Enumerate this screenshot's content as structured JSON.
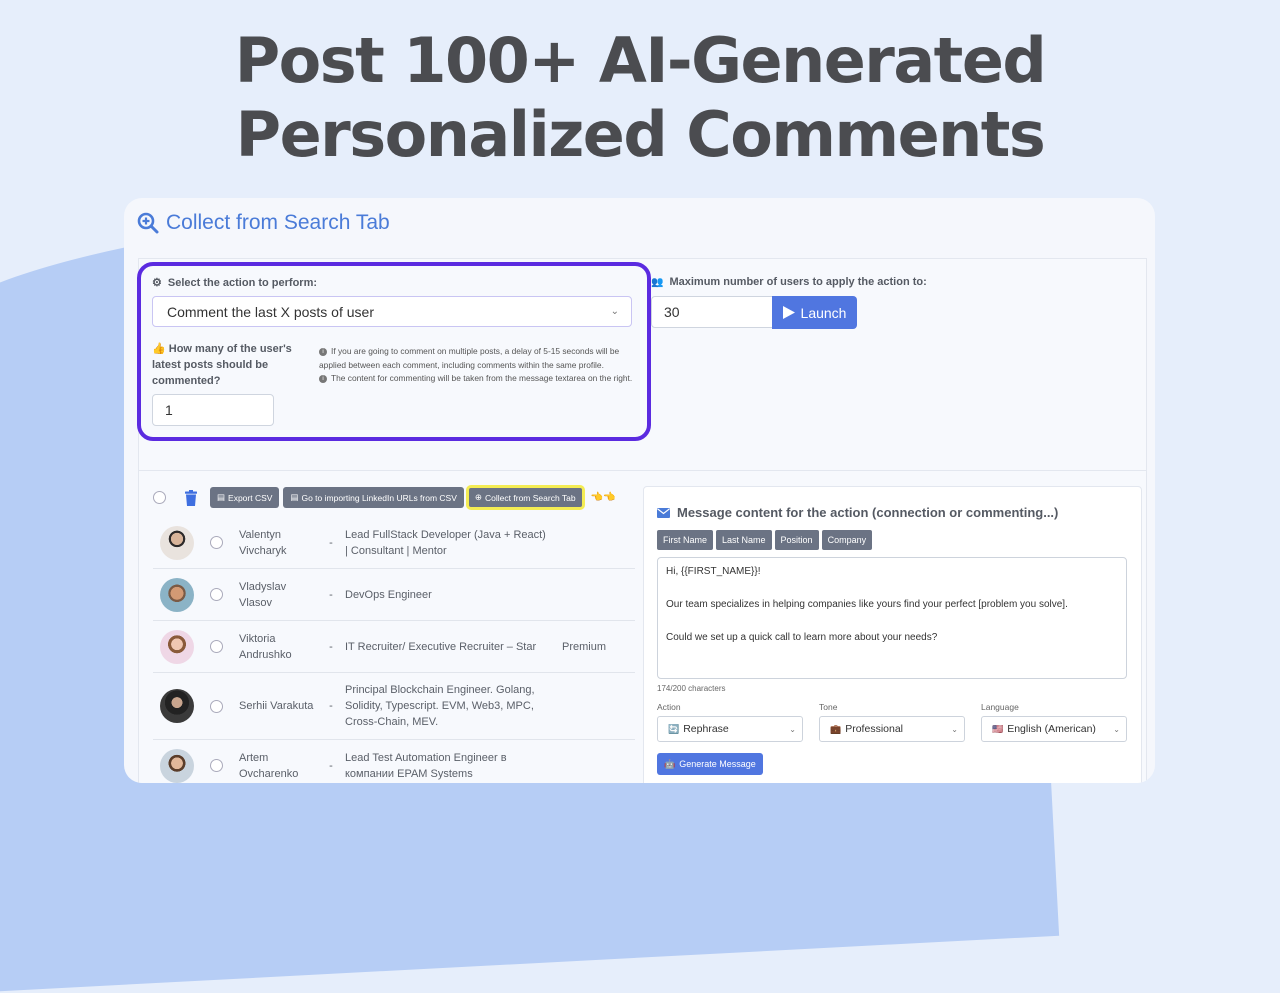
{
  "hero": {
    "line1": "Post 100+ AI-Generated",
    "line2": "Personalized Comments"
  },
  "card": {
    "title": "Collect from Search Tab",
    "title_icon": "search-plus-icon"
  },
  "action": {
    "label": "Select the action to perform:",
    "selected": "Comment the last X posts of user",
    "posts_label": "How many of the user's latest posts should be commented?",
    "posts_value": "1",
    "info1": "If you are going to comment on multiple posts, a delay of 5-15 seconds will be applied between each comment, including comments within the same profile.",
    "info2": "The content for commenting will be taken from the message textarea on the right."
  },
  "limit": {
    "label": "Maximum number of users to apply the action to:",
    "value": "30",
    "launch_label": "Launch"
  },
  "toolbar": {
    "export_csv": "Export CSV",
    "import_csv": "Go to importing LinkedIn URLs from CSV",
    "collect_search": "Collect from Search Tab"
  },
  "users": [
    {
      "name": "Valentyn Vivcharyk",
      "position": "Lead FullStack Developer (Java + React) | Consultant | Mentor",
      "premium": ""
    },
    {
      "name": "Vladyslav Vlasov",
      "position": "DevOps Engineer",
      "premium": ""
    },
    {
      "name": "Viktoria Andrushko",
      "position": "IT Recruiter/ Executive Recruiter – Star",
      "premium": "Premium"
    },
    {
      "name": "Serhii Varakuta",
      "position": "Principal Blockchain Engineer. Golang, Solidity, Typescript. EVM, Web3, MPC, Cross-Chain, MEV.",
      "premium": ""
    },
    {
      "name": "Artem Ovcharenko",
      "position": "Lead Test Automation Engineer в компании EPAM Systems",
      "premium": ""
    }
  ],
  "message": {
    "title": "Message content for the action (connection or commenting...)",
    "placeholders": [
      "First Name",
      "Last Name",
      "Position",
      "Company"
    ],
    "line1": "Hi, {{FIRST_NAME}}!",
    "line2": "Our team specializes in helping companies like yours find your perfect [problem you solve].",
    "line3": "Could we set up a quick call to learn more about your needs?",
    "char_count": "174/200 characters",
    "action_label": "Action",
    "action_value": "Rephrase",
    "tone_label": "Tone",
    "tone_value": "Professional",
    "language_label": "Language",
    "language_value": "English (American)",
    "generate_label": "Generate Message"
  },
  "colors": {
    "accent": "#5076e0",
    "highlight": "#5b2be0",
    "title_blue": "#4a7bd8"
  }
}
